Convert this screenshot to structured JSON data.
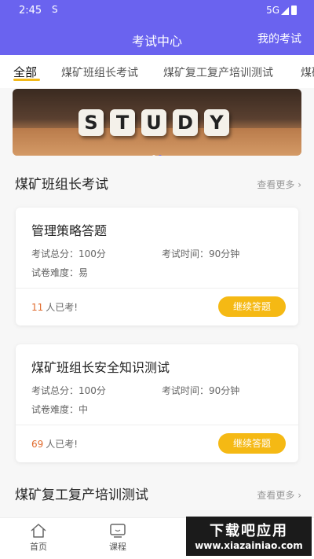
{
  "status_bar": {
    "time": "2:45",
    "s_icon": "S",
    "network": "5G"
  },
  "app_bar": {
    "title": "考试中心",
    "my_exams": "我的考试"
  },
  "tabs": [
    {
      "label": "全部",
      "active": true
    },
    {
      "label": "煤矿班组长考试"
    },
    {
      "label": "煤矿复工复产培训测试"
    },
    {
      "label": "煤矿"
    }
  ],
  "banner": {
    "letters": [
      "S",
      "T",
      "U",
      "D",
      "Y"
    ]
  },
  "sections": [
    {
      "title": "煤矿班组长考试",
      "more": "查看更多 ›",
      "cards": [
        {
          "title": "管理策略答题",
          "score_label": "考试总分：100分",
          "time_label": "考试时间：90分钟",
          "difficulty_label": "试卷难度：易",
          "count": "11",
          "count_suffix": "人已考!",
          "button": "继续答题"
        },
        {
          "title": "煤矿班组长安全知识测试",
          "score_label": "考试总分：100分",
          "time_label": "考试时间：90分钟",
          "difficulty_label": "试卷难度：中",
          "count": "69",
          "count_suffix": "人已考!",
          "button": "继续答题"
        }
      ]
    },
    {
      "title": "煤矿复工复产培训测试",
      "more": "查看更多 ›"
    }
  ],
  "bottom_nav": [
    {
      "label": "首页",
      "icon": "home-icon"
    },
    {
      "label": "课程",
      "icon": "course-icon"
    }
  ],
  "watermark": {
    "line1": "下载吧应用",
    "line2": "www.xiazainiao.com"
  },
  "colors": {
    "primary": "#6a63ef",
    "accent": "#f5b914",
    "count": "#e06a2c"
  }
}
